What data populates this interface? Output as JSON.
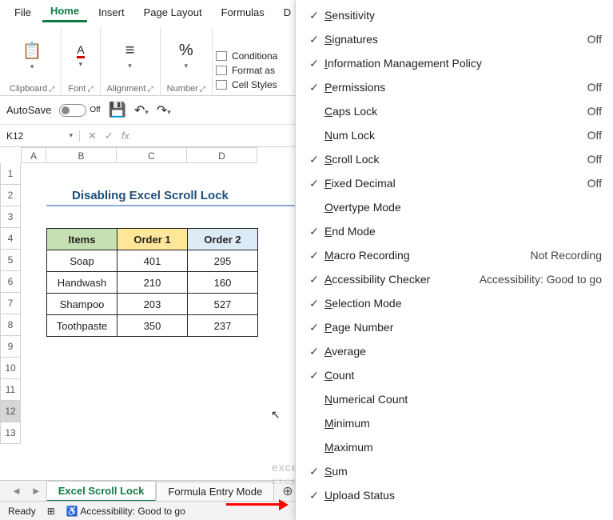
{
  "menubar": {
    "items": [
      "File",
      "Home",
      "Insert",
      "Page Layout",
      "Formulas",
      "D"
    ],
    "active_index": 1
  },
  "ribbon": {
    "clipboard": {
      "label": "Clipboard"
    },
    "font": {
      "label": "Font"
    },
    "alignment": {
      "label": "Alignment"
    },
    "number": {
      "label": "Number"
    },
    "styles": {
      "conditional": "Conditiona",
      "formatas": "Format as",
      "cellstyles": "Cell Styles"
    }
  },
  "autosave": {
    "label": "AutoSave",
    "state": "Off"
  },
  "namebox": {
    "value": "K12"
  },
  "fx": {
    "label": "fx"
  },
  "columns": [
    "A",
    "B",
    "C",
    "D"
  ],
  "rows": [
    "1",
    "2",
    "3",
    "4",
    "5",
    "6",
    "7",
    "8",
    "9",
    "10",
    "11",
    "12",
    "13"
  ],
  "title": "Disabling Excel Scroll Lock",
  "table": {
    "headers": [
      "Items",
      "Order 1",
      "Order 2"
    ],
    "rows": [
      [
        "Soap",
        "401",
        "295"
      ],
      [
        "Handwash",
        "210",
        "160"
      ],
      [
        "Shampoo",
        "203",
        "527"
      ],
      [
        "Toothpaste",
        "350",
        "237"
      ]
    ]
  },
  "sheet_tabs": {
    "tabs": [
      "Excel Scroll Lock",
      "Formula Entry Mode"
    ],
    "active_index": 0
  },
  "status": {
    "ready": "Ready",
    "accessibility": "Accessibility: Good to go"
  },
  "ctx": {
    "items": [
      {
        "check": true,
        "label": "Sensitivity",
        "value": ""
      },
      {
        "check": true,
        "label": "Signatures",
        "value": "Off"
      },
      {
        "check": true,
        "label": "Information Management Policy",
        "value": ""
      },
      {
        "check": true,
        "label": "Permissions",
        "value": "Off"
      },
      {
        "check": false,
        "label": "Caps Lock",
        "value": "Off"
      },
      {
        "check": false,
        "label": "Num Lock",
        "value": "Off"
      },
      {
        "check": true,
        "label": "Scroll Lock",
        "value": "Off"
      },
      {
        "check": true,
        "label": "Fixed Decimal",
        "value": "Off"
      },
      {
        "check": false,
        "label": "Overtype Mode",
        "value": ""
      },
      {
        "check": true,
        "label": "End Mode",
        "value": ""
      },
      {
        "check": true,
        "label": "Macro Recording",
        "value": "Not Recording"
      },
      {
        "check": true,
        "label": "Accessibility Checker",
        "value": "Accessibility: Good to go"
      },
      {
        "check": true,
        "label": "Selection Mode",
        "value": ""
      },
      {
        "check": true,
        "label": "Page Number",
        "value": ""
      },
      {
        "check": true,
        "label": "Average",
        "value": ""
      },
      {
        "check": true,
        "label": "Count",
        "value": ""
      },
      {
        "check": false,
        "label": "Numerical Count",
        "value": ""
      },
      {
        "check": false,
        "label": "Minimum",
        "value": ""
      },
      {
        "check": false,
        "label": "Maximum",
        "value": ""
      },
      {
        "check": true,
        "label": "Sum",
        "value": ""
      },
      {
        "check": true,
        "label": "Upload Status",
        "value": ""
      }
    ]
  },
  "watermark": {
    "main": "exceldemy",
    "sub": "EXCEL & DATA & BI"
  }
}
